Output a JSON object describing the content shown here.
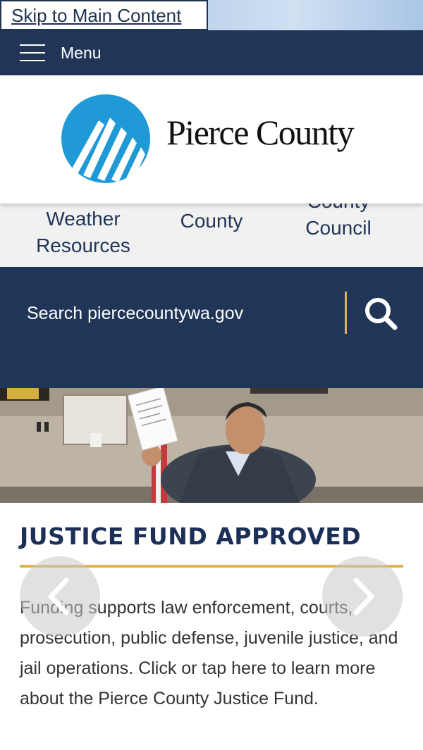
{
  "skip_link": "Skip to Main Content",
  "menu": {
    "label": "Menu"
  },
  "logo": {
    "text": "Pierce County"
  },
  "quicklinks": [
    {
      "label": "Weather Resources"
    },
    {
      "label": "Pierce County"
    },
    {
      "label": "County Council"
    }
  ],
  "search": {
    "placeholder": "Search piercecountywa.gov"
  },
  "slide": {
    "title": "JUSTICE FUND APPROVED",
    "body": "Funding supports law enforcement, courts, prosecution, public defense, juvenile justice, and jail operations. Click or tap here to learn more about the Pierce County Justice Fund."
  },
  "colors": {
    "navy": "#213657",
    "gold": "#e0b24a",
    "logo_blue": "#1f9ad6"
  },
  "icons": {
    "menu": "hamburger-icon",
    "search": "search-icon",
    "prev": "chevron-left-icon",
    "next": "chevron-right-icon"
  }
}
